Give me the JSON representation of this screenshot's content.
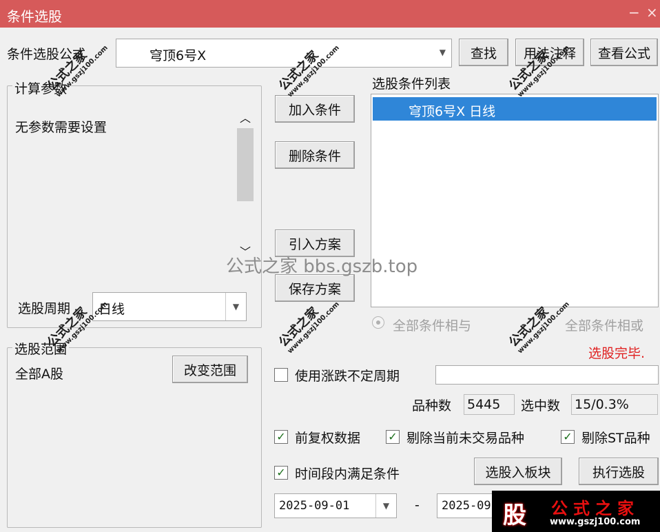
{
  "window": {
    "title": "条件选股",
    "controls": [
      "−",
      "×"
    ]
  },
  "formula": {
    "label": "条件选股公式",
    "value": "穹顶6号X",
    "find_button": "查找",
    "usage_button": "用法注释",
    "view_button": "查看公式"
  },
  "params": {
    "legend": "计算参数",
    "text": "无参数需要设置",
    "scroll_up": "︿",
    "scroll_down": "﹀"
  },
  "period": {
    "label": "选股周期",
    "value": "日线"
  },
  "scope": {
    "legend": "选股范围",
    "value": "全部A股",
    "change_button": "改变范围"
  },
  "actions": {
    "add": "加入条件",
    "delete": "删除条件",
    "import": "引入方案",
    "save": "保存方案"
  },
  "conditions": {
    "header": "选股条件列表",
    "items": [
      "穹顶6号X  日线"
    ]
  },
  "logic": {
    "and": "全部条件相与",
    "or": "全部条件相或"
  },
  "status": {
    "text": "选股完毕.",
    "color": "#e02020"
  },
  "uncertain_period": {
    "label": "使用涨跌不定周期",
    "checked": false,
    "value": ""
  },
  "stats": {
    "count_label": "品种数",
    "count_value": "5445",
    "selected_label": "选中数",
    "selected_value": "15/0.3%"
  },
  "options": [
    {
      "label": "前复权数据",
      "checked": true
    },
    {
      "label": "剔除当前未交易品种",
      "checked": true
    },
    {
      "label": "剔除ST品种",
      "checked": true
    },
    {
      "label": "时间段内满足条件",
      "checked": true
    }
  ],
  "check_mark": "✓",
  "buttons": {
    "to_block": "选股入板块",
    "execute": "执行选股"
  },
  "dates": {
    "from": "2025-09-01",
    "separator": "-",
    "to": "2025-09"
  },
  "watermark": {
    "brand": "公式之家",
    "site": "www.gszj100.com",
    "center": "公式之家 bbs.gszb.top",
    "logo_char": "股"
  }
}
